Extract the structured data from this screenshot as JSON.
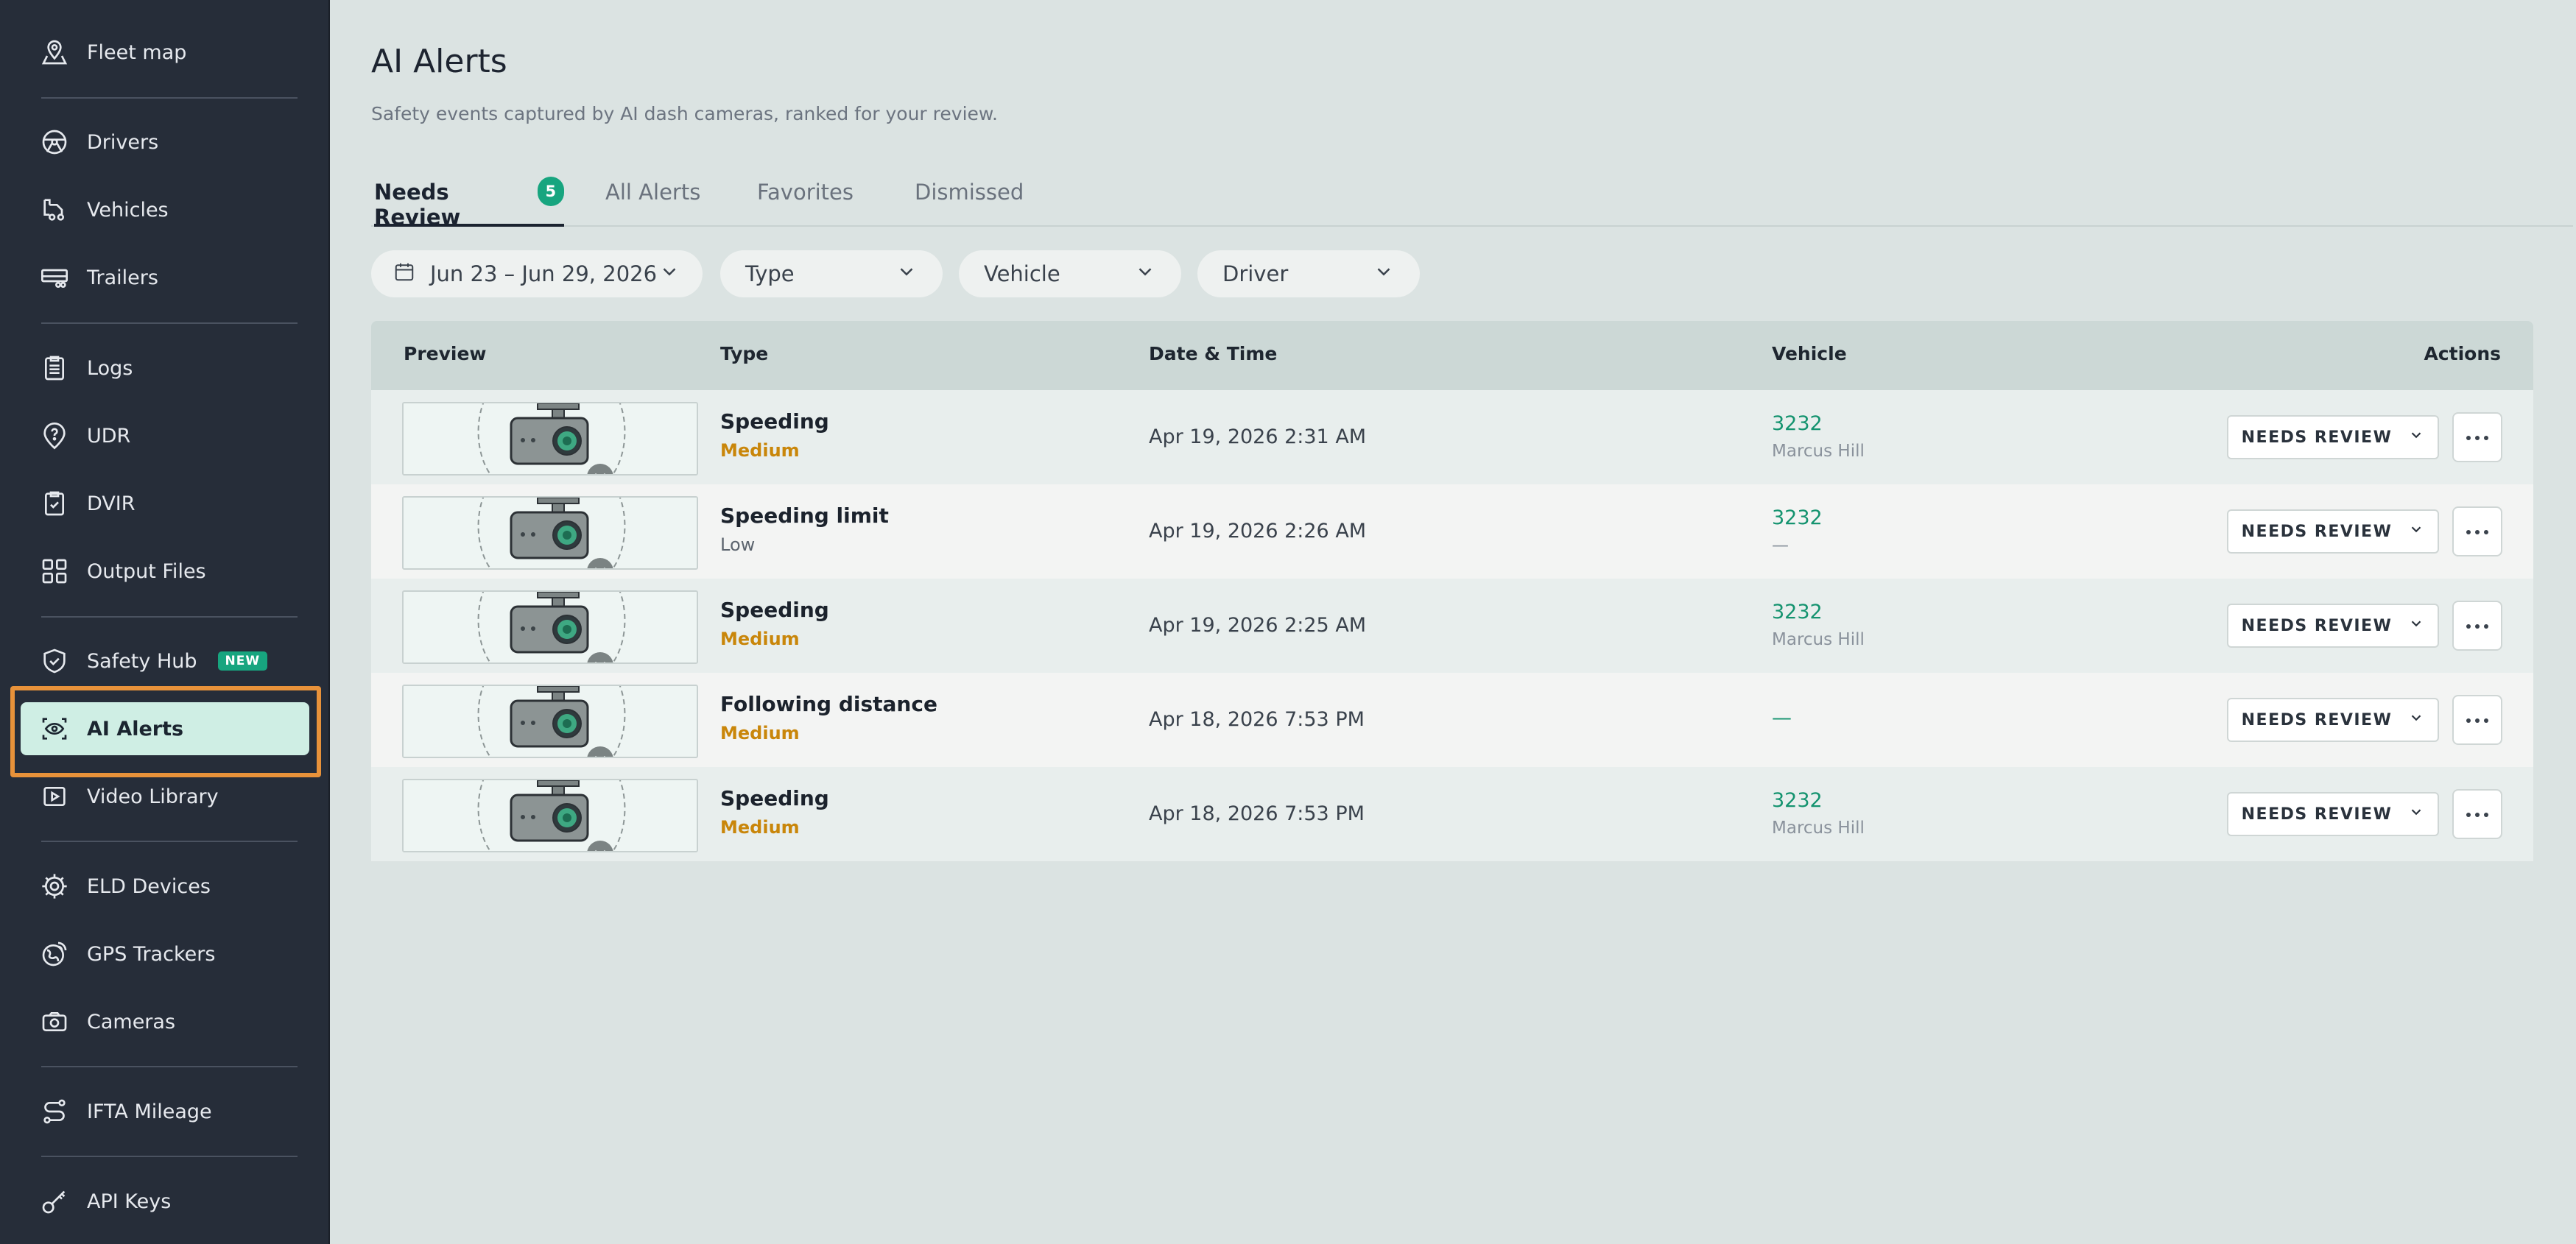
{
  "sidebar": {
    "items": [
      {
        "label": "Fleet map",
        "icon": "map-pin-icon"
      },
      {
        "label": "Drivers",
        "icon": "steering-wheel-icon"
      },
      {
        "label": "Vehicles",
        "icon": "truck-icon"
      },
      {
        "label": "Trailers",
        "icon": "trailer-icon"
      },
      {
        "label": "Logs",
        "icon": "clipboard-icon"
      },
      {
        "label": "UDR",
        "icon": "question-pin-icon"
      },
      {
        "label": "DVIR",
        "icon": "checklist-icon"
      },
      {
        "label": "Output Files",
        "icon": "grid-icon"
      },
      {
        "label": "Safety Hub",
        "icon": "shield-check-icon",
        "badge": "NEW"
      },
      {
        "label": "AI Alerts",
        "icon": "eye-scan-icon",
        "active": true
      },
      {
        "label": "Video Library",
        "icon": "play-icon"
      },
      {
        "label": "ELD Devices",
        "icon": "chip-icon"
      },
      {
        "label": "GPS Trackers",
        "icon": "gps-icon"
      },
      {
        "label": "Cameras",
        "icon": "camera-icon"
      },
      {
        "label": "IFTA Mileage",
        "icon": "route-icon"
      },
      {
        "label": "API Keys",
        "icon": "key-icon"
      }
    ]
  },
  "header": {
    "title": "AI Alerts",
    "subtitle": "Safety events captured by AI dash cameras, ranked for your review."
  },
  "tabs": [
    {
      "label": "Needs Review",
      "count": "5",
      "active": true
    },
    {
      "label": "All Alerts"
    },
    {
      "label": "Favorites"
    },
    {
      "label": "Dismissed"
    }
  ],
  "filters": {
    "date": "Jun 23 – Jun 29, 2026",
    "type": "Type",
    "vehicle": "Vehicle",
    "driver": "Driver"
  },
  "table": {
    "headers": {
      "preview": "Preview",
      "type": "Type",
      "datetime": "Date & Time",
      "vehicle": "Vehicle",
      "actions": "Actions"
    },
    "rows": [
      {
        "type": "Speeding",
        "severity": "Medium",
        "datetime": "Apr 19, 2026 2:31 AM",
        "vehicle": "3232",
        "driver": "Marcus Hill",
        "status": "NEEDS REVIEW"
      },
      {
        "type": "Speeding limit",
        "severity": "Low",
        "datetime": "Apr 19, 2026 2:26 AM",
        "vehicle": "3232",
        "driver": "—",
        "status": "NEEDS REVIEW"
      },
      {
        "type": "Speeding",
        "severity": "Medium",
        "datetime": "Apr 19, 2026 2:25 AM",
        "vehicle": "3232",
        "driver": "Marcus Hill",
        "status": "NEEDS REVIEW"
      },
      {
        "type": "Following distance",
        "severity": "Medium",
        "datetime": "Apr 18, 2026 7:53 PM",
        "vehicle": "—",
        "driver": "",
        "status": "NEEDS REVIEW"
      },
      {
        "type": "Speeding",
        "severity": "Medium",
        "datetime": "Apr 18, 2026 7:53 PM",
        "vehicle": "3232",
        "driver": "Marcus Hill",
        "status": "NEEDS REVIEW"
      }
    ]
  },
  "colors": {
    "sidebar_bg": "#262d39",
    "accent_green": "#17a57f",
    "severity_medium": "#c9860a",
    "active_highlight": "#e8923a"
  }
}
